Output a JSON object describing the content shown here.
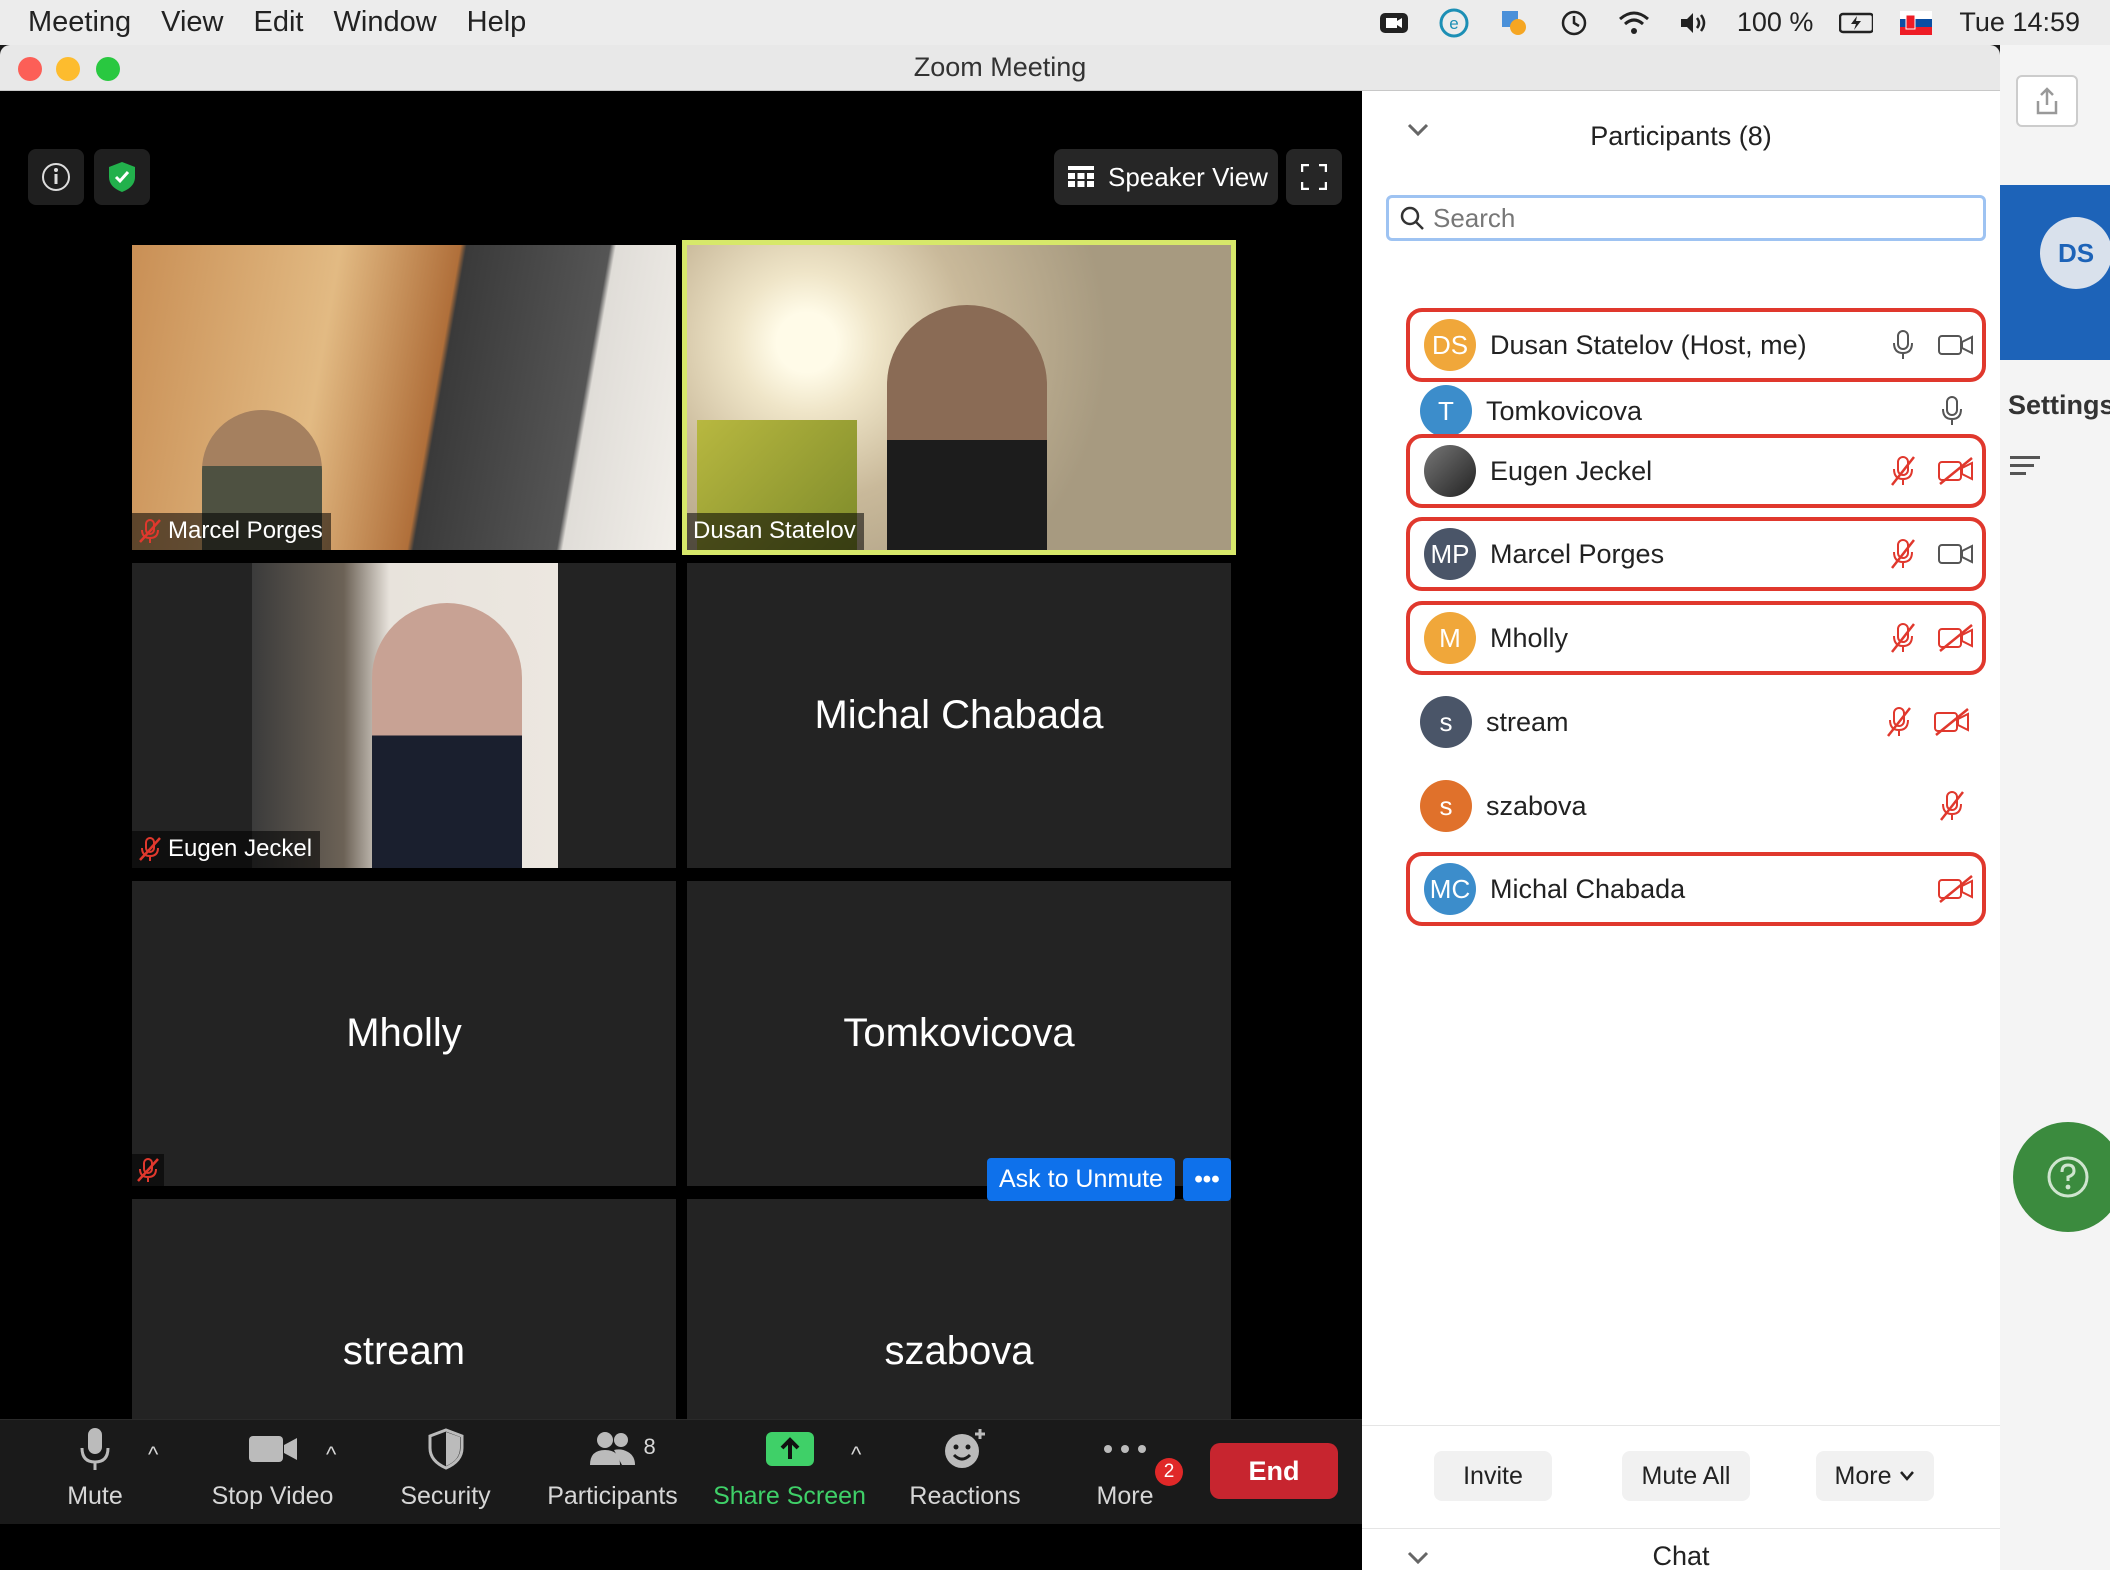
{
  "menubar": {
    "items": [
      "Meeting",
      "View",
      "Edit",
      "Window",
      "Help"
    ],
    "battery": "100 %",
    "clock": "Tue 14:59"
  },
  "window": {
    "title": "Zoom Meeting"
  },
  "top_controls": {
    "speaker_view": "Speaker View"
  },
  "tiles": [
    {
      "name": "Marcel Porges",
      "video": true,
      "muted": true
    },
    {
      "name": "Dusan Statelov",
      "video": true,
      "muted": false,
      "active_speaker": true
    },
    {
      "name": "Eugen Jeckel",
      "video": true,
      "muted": true
    },
    {
      "name": "Michal Chabada",
      "video": false,
      "muted": false
    },
    {
      "name": "Mholly",
      "video": false,
      "muted": true
    },
    {
      "name": "Tomkovicova",
      "video": false,
      "muted": false
    },
    {
      "name": "stream",
      "video": false,
      "muted": true
    },
    {
      "name": "szabova",
      "video": false,
      "muted": true
    }
  ],
  "tile_actions": {
    "ask_to_unmute": "Ask to Unmute",
    "more": "•••"
  },
  "toolbar": {
    "mute": "Mute",
    "stop_video": "Stop Video",
    "security": "Security",
    "participants": "Participants",
    "participants_count": "8",
    "share_screen": "Share Screen",
    "reactions": "Reactions",
    "more": "More",
    "more_badge": "2",
    "end": "End"
  },
  "panel": {
    "title": "Participants (8)",
    "search_placeholder": "Search",
    "participants": [
      {
        "initials": "DS",
        "name": "Dusan Statelov (Host, me)",
        "color": "#f0a73a",
        "mic": "on",
        "cam": "on",
        "highlighted": true
      },
      {
        "initials": "T",
        "name": "Tomkovicova",
        "color": "#3c8dcb",
        "mic": "on",
        "cam": "none",
        "highlighted": false
      },
      {
        "initials": "",
        "name": "Eugen Jeckel",
        "color": "#555555",
        "mic": "off",
        "cam": "off",
        "highlighted": true
      },
      {
        "initials": "MP",
        "name": "Marcel Porges",
        "color": "#4a5568",
        "mic": "off",
        "cam": "on",
        "highlighted": true
      },
      {
        "initials": "M",
        "name": "Mholly",
        "color": "#f0a73a",
        "mic": "off",
        "cam": "off",
        "highlighted": true
      },
      {
        "initials": "s",
        "name": "stream",
        "color": "#4a5568",
        "mic": "off",
        "cam": "off",
        "highlighted": false
      },
      {
        "initials": "s",
        "name": "szabova",
        "color": "#e0712b",
        "mic": "off",
        "cam": "none",
        "highlighted": false
      },
      {
        "initials": "MC",
        "name": "Michal Chabada",
        "color": "#3c8dcb",
        "mic": "none",
        "cam": "off",
        "highlighted": true
      }
    ],
    "invite": "Invite",
    "mute_all": "Mute All",
    "more": "More",
    "chat": "Chat"
  },
  "background_app": {
    "avatar": "DS",
    "settings": "Settings"
  },
  "colors": {
    "highlight": "#e0382d",
    "share_green": "#3fd068",
    "end_red": "#c7252f",
    "zoom_blue": "#0e71eb",
    "muted_red": "#e0382d"
  }
}
